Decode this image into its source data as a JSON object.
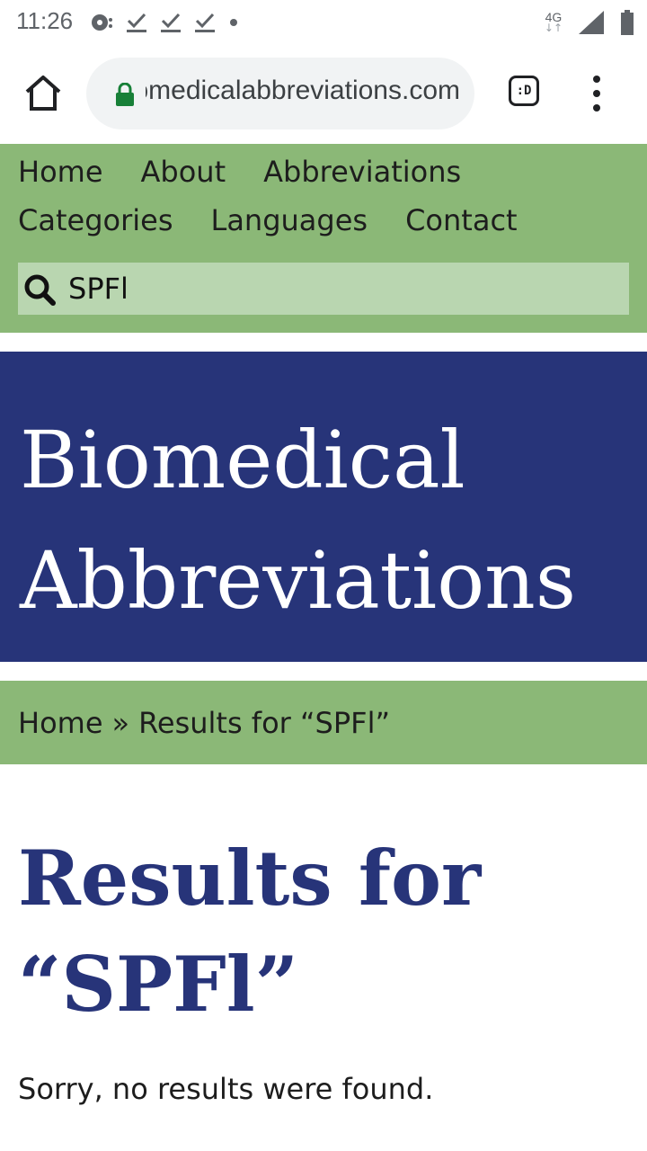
{
  "status_bar": {
    "time": "11:26",
    "network": "4G"
  },
  "browser": {
    "url": "biomedicalabbreviations.com",
    "tab_label": ":D"
  },
  "nav": {
    "items_row1": [
      "Home",
      "About",
      "Abbreviations"
    ],
    "items_row2": [
      "Categories",
      "Languages",
      "Contact"
    ]
  },
  "search": {
    "value": "SPFl"
  },
  "banner": {
    "title_line1": "Biomedical",
    "title_line2": "Abbreviations"
  },
  "breadcrumb": {
    "home": "Home",
    "separator": "»",
    "current": "Results for “SPFl”"
  },
  "main": {
    "heading_line1": "Results for",
    "heading_line2": "“SPFl”",
    "message": "Sorry, no results were found."
  },
  "colors": {
    "nav_green": "#8bb877",
    "search_green": "#b9d6b0",
    "banner_blue": "#273479",
    "heading_blue": "#273479"
  }
}
